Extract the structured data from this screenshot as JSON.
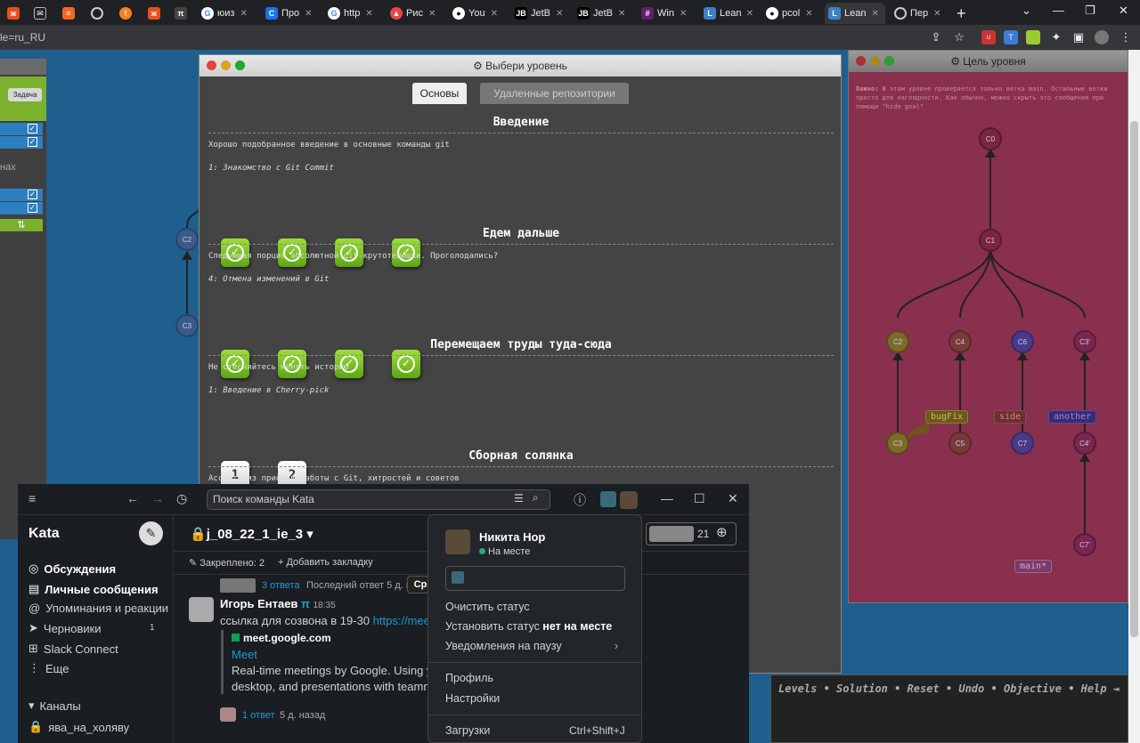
{
  "browser": {
    "tabs": [
      "",
      "",
      "",
      "",
      "",
      "",
      "юиз",
      "Про",
      "http",
      "Рис",
      "You",
      "JetB",
      "JetB",
      "Win",
      "Lean",
      "pcol",
      "Lean",
      "Пер"
    ],
    "url": "le=ru_RU"
  },
  "left_panel": {
    "task_label": "Задача",
    "partial_text": "нах",
    "node_c2": "C2",
    "node_c3": "C3"
  },
  "level_window": {
    "title": "⚙ Выбери уровень",
    "tab_main": "Основы",
    "tab_remote": "Удаленные репозитории",
    "sections": [
      {
        "title": "Введение",
        "desc": "Хорошо подобранное введение в основные команды git",
        "sub": "1: Знакомство с Git Commit"
      },
      {
        "title": "Едем дальше",
        "desc": "Следующая порция абсолютной git-крутотенюшки. Проголодались?",
        "sub": "4: Отмена изменений в Git"
      },
      {
        "title": "Перемещаем труды туда-сюда",
        "desc": "Не стесняйтесь менять историю",
        "sub": "1: Введение в Cherry-pick",
        "buttons": [
          "1",
          "2"
        ]
      },
      {
        "title": "Сборная солянка",
        "desc": "Ассорти из приёмов работы с Git, хитростей и советов"
      }
    ]
  },
  "goal_window": {
    "title": "⚙ Цель уровня",
    "note_bold": "Важно:",
    "note": " В этом уровне проверяется только ветка main. Остальные ветки просто для наглядности. Как обычно, можно скрыть это сообщение при помощи \"hide goal\"",
    "nodes": [
      "C0",
      "C1",
      "C2",
      "C4",
      "C6",
      "C3'",
      "C3",
      "C5",
      "C7",
      "C4'",
      "C7'"
    ],
    "branches": [
      "bugFix",
      "side",
      "another",
      "main*"
    ]
  },
  "command_bar": {
    "items": [
      "Levels",
      "Solution",
      "Reset",
      "Undo",
      "Objective",
      "Help"
    ]
  },
  "slack": {
    "search_placeholder": "Поиск команды Kata",
    "workspace": "Kata",
    "sidebar": [
      "Обсуждения",
      "Личные сообщения",
      "Упоминания и реакции",
      "Черновики",
      "Slack Connect",
      "Еще"
    ],
    "drafts_count": "1",
    "channels_header": "Каналы",
    "channel_item": "ява_на_холяву",
    "channel": "j_08_22_1_ie_3",
    "members_count": "21",
    "pinned": "Закреплено: 2",
    "add_bookmark": "Добавить закладку",
    "thread1_replies": "3 ответа",
    "thread1_last": "Последний ответ 5 д. назад",
    "author": "Игорь Ентаев",
    "time": "18:35",
    "msg_text": "ссылка для созвона в 19-30 ",
    "msg_link": "https://meet.g",
    "preview_site": "meet.google.com",
    "preview_title": "Meet",
    "preview_desc1": "Real-time meetings by Google. Using your",
    "preview_desc2": "desktop, and presentations with teammat",
    "thread2_replies": "1 ответ",
    "thread2_last": "5 д. назад",
    "cut_btn": "Ср"
  },
  "popup": {
    "name": "Никита Нор",
    "status": "На месте",
    "clear": "Очистить статус",
    "set_away_prefix": "Установить статус ",
    "set_away_bold": "нет на месте",
    "pause": "Уведомления на паузу",
    "profile": "Профиль",
    "settings": "Настройки",
    "downloads": "Загрузки",
    "downloads_shortcut": "Ctrl+Shift+J"
  },
  "colors": {
    "goal_bg": "#88304e",
    "level_bg": "#444444",
    "page_bg": "#1f5f8e",
    "slack_bg": "#1a1d21"
  }
}
